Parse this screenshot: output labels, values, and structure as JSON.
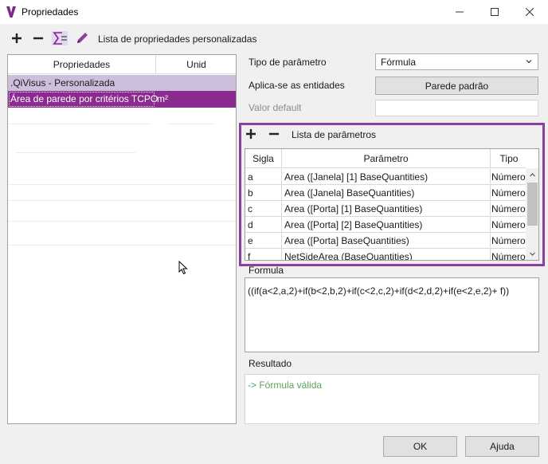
{
  "window": {
    "title": "Propriedades",
    "icon": "qivisus-logo",
    "controls": [
      "minimize-icon",
      "maximize-icon",
      "close-icon"
    ]
  },
  "toolbar": {
    "icons": [
      "plus-icon",
      "minus-icon",
      "sum-formula-icon",
      "pencil-icon"
    ],
    "label": "Lista de propriedades personalizadas"
  },
  "properties": {
    "columns": [
      "Propriedades",
      "Unid"
    ],
    "group": ".QiVisus - Personalizada",
    "selected": {
      "name": "Área de parede por critérios TCPO",
      "unit": "m²"
    }
  },
  "form": {
    "param_type_label": "Tipo de parâmetro",
    "param_type_value": "Fórmula",
    "applies_label": "Aplica-se as entidades",
    "applies_button": "Parede padrão",
    "default_label": "Valor default",
    "default_value": ""
  },
  "param_list": {
    "label": "Lista de parâmetros",
    "columns": [
      "Sigla",
      "Parâmetro",
      "Tipo"
    ],
    "rows": [
      {
        "sigla": "a",
        "param": "Area ([Janela] [1] BaseQuantities)",
        "tipo": "Número"
      },
      {
        "sigla": "b",
        "param": "Area ([Janela] BaseQuantities)",
        "tipo": "Número"
      },
      {
        "sigla": "c",
        "param": "Area ([Porta] [1] BaseQuantities)",
        "tipo": "Número"
      },
      {
        "sigla": "d",
        "param": "Area ([Porta] [2] BaseQuantities)",
        "tipo": "Número"
      },
      {
        "sigla": "e",
        "param": "Area ([Porta] BaseQuantities)",
        "tipo": "Número"
      },
      {
        "sigla": "f",
        "param": "NetSideArea (BaseQuantities)",
        "tipo": "Número"
      }
    ]
  },
  "formula": {
    "label": "Formula",
    "value": "((if(a<2,a,2)+if(b<2,b,2)+if(c<2,c,2)+if(d<2,d,2)+if(e<2,e,2)+ f))"
  },
  "result": {
    "label": "Resultado",
    "value": "-> Fórmula válida"
  },
  "buttons": {
    "ok": "OK",
    "help": "Ajuda"
  },
  "colors": {
    "accent": "#8c3fa3",
    "selection": "#8b2a8f",
    "group_row": "#cdbfdc",
    "valid_text": "#5ba35b"
  }
}
